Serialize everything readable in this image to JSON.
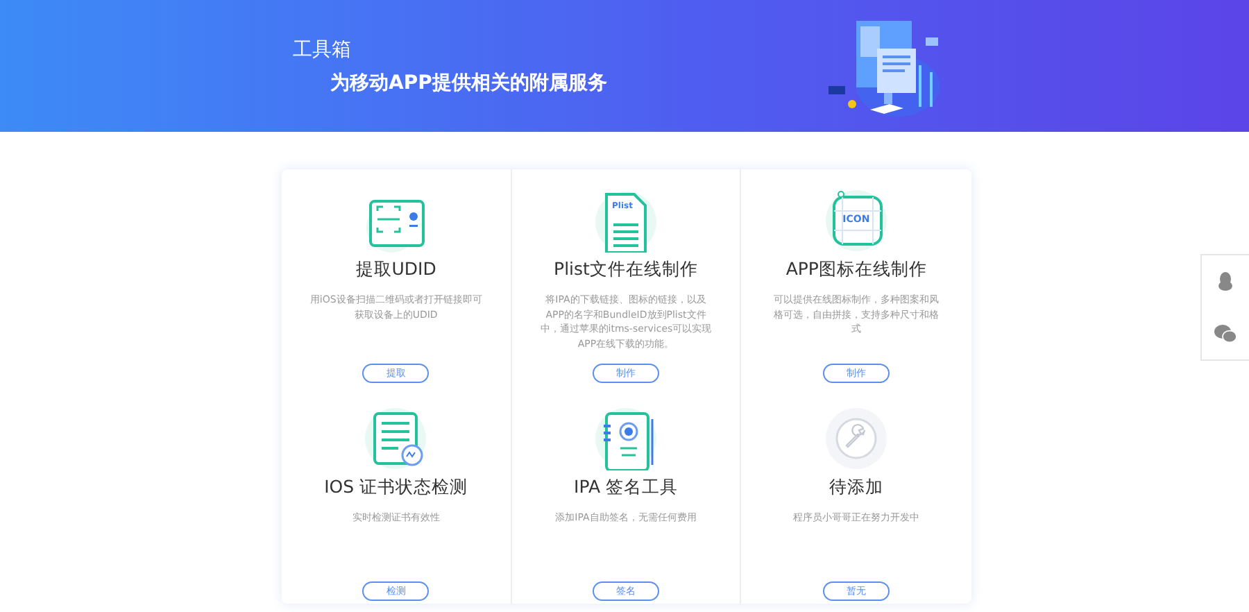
{
  "banner": {
    "title": "工具箱",
    "subtitle": "为移动APP提供相关的附属服务"
  },
  "tools": [
    {
      "kind": "udid",
      "title": "提取UDID",
      "description": "用iOS设备扫描二维码或者打开链接即可获取设备上的UDID",
      "button": "提取"
    },
    {
      "kind": "plist",
      "icon_text": "Plist",
      "title": "Plist文件在线制作",
      "description": "将IPA的下载链接、图标的链接，以及APP的名字和BundleID放到Plist文件中，通过苹果的itms-services可以实现APP在线下载的功能。",
      "button": "制作"
    },
    {
      "kind": "appicon",
      "icon_text": "ICON",
      "title": "APP图标在线制作",
      "description": "可以提供在线图标制作，多种图案和风格可选，自由拼接，支持多种尺寸和格式",
      "button": "制作"
    },
    {
      "kind": "cert",
      "title": "IOS 证书状态检测",
      "description": "实时检测证书有效性",
      "button": "检测"
    },
    {
      "kind": "sign",
      "title": "IPA 签名工具",
      "description": "添加IPA自助签名，无需任何费用",
      "button": "签名"
    },
    {
      "kind": "pending",
      "title": "待添加",
      "description": "程序员小哥哥正在努力开发中",
      "button": "暂无"
    }
  ],
  "side_contacts": [
    {
      "kind": "qq"
    },
    {
      "kind": "wechat"
    }
  ]
}
